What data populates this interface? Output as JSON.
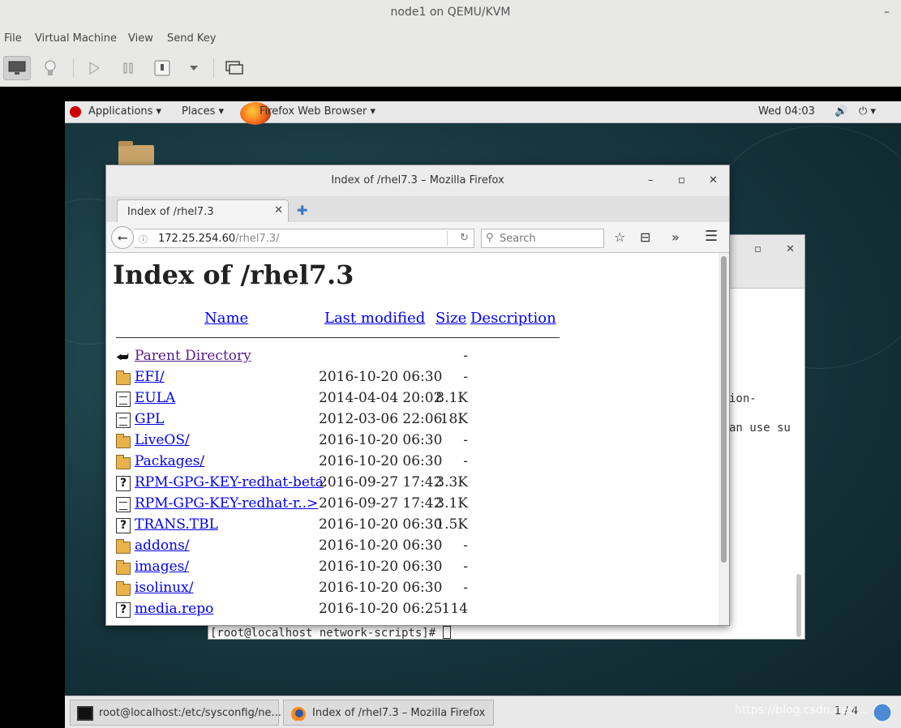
{
  "host": {
    "title": "node1 on QEMU/KVM",
    "minimize": "–",
    "menu": [
      "File",
      "Virtual Machine",
      "View",
      "Send Key"
    ]
  },
  "guest": {
    "topbar": {
      "applications": "Applications ▾",
      "places": "Places ▾",
      "firefox": "Firefox Web Browser ▾",
      "clock": "Wed 04:03",
      "volume": "🔊",
      "power": "⏻ ▾"
    },
    "terminal": {
      "lines": [
        {
          "text": "ion-"
        },
        {
          "text": "an use su"
        }
      ],
      "prompt": "[root@localhost network-scripts]# "
    },
    "firefox": {
      "window_title": "Index of /rhel7.3 – Mozilla Firefox",
      "tab_label": "Index of /rhel7.3",
      "url_host": "172.25.254.60",
      "url_path": "/rhel7.3/",
      "search_placeholder": "Search",
      "page": {
        "heading": "Index of /rhel7.3",
        "columns": {
          "name": "Name",
          "modified": "Last modified",
          "size": "Size",
          "desc": "Description"
        },
        "rows": [
          {
            "icon": "back",
            "name": "Parent Directory",
            "date": "",
            "size": "-"
          },
          {
            "icon": "folder",
            "name": "EFI/",
            "date": "2016-10-20 06:30",
            "size": "-"
          },
          {
            "icon": "doc",
            "name": "EULA",
            "date": "2014-04-04 20:02",
            "size": "8.1K"
          },
          {
            "icon": "doc",
            "name": "GPL",
            "date": "2012-03-06 22:06",
            "size": "18K"
          },
          {
            "icon": "folder",
            "name": "LiveOS/",
            "date": "2016-10-20 06:30",
            "size": "-"
          },
          {
            "icon": "folder",
            "name": "Packages/",
            "date": "2016-10-20 06:30",
            "size": "-"
          },
          {
            "icon": "unknown",
            "name": "RPM-GPG-KEY-redhat-beta",
            "date": "2016-09-27 17:42",
            "size": "3.3K"
          },
          {
            "icon": "doc",
            "name": "RPM-GPG-KEY-redhat-r..>",
            "date": "2016-09-27 17:42",
            "size": "3.1K"
          },
          {
            "icon": "unknown",
            "name": "TRANS.TBL",
            "date": "2016-10-20 06:30",
            "size": "1.5K"
          },
          {
            "icon": "folder",
            "name": "addons/",
            "date": "2016-10-20 06:30",
            "size": "-"
          },
          {
            "icon": "folder",
            "name": "images/",
            "date": "2016-10-20 06:30",
            "size": "-"
          },
          {
            "icon": "folder",
            "name": "isolinux/",
            "date": "2016-10-20 06:30",
            "size": "-"
          },
          {
            "icon": "unknown",
            "name": "media.repo",
            "date": "2016-10-20 06:25",
            "size": "114"
          }
        ]
      }
    },
    "taskbar": {
      "tasks": [
        {
          "label": "root@localhost:/etc/sysconfig/ne..."
        },
        {
          "label": "Index of /rhel7.3 – Mozilla Firefox"
        }
      ],
      "workspace": "1 / 4"
    }
  },
  "watermark": "https://blog.csdn.net/..."
}
